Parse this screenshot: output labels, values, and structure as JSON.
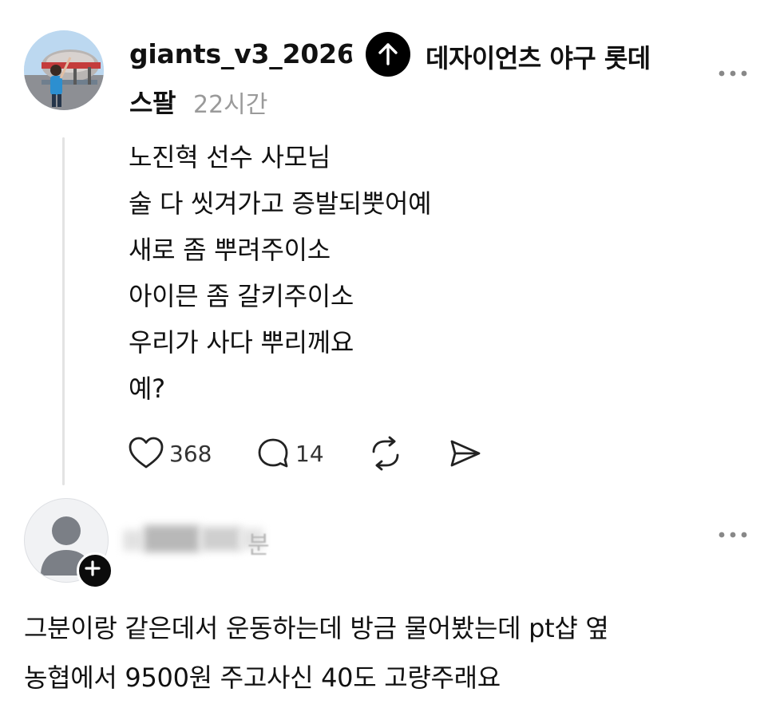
{
  "post": {
    "username": "giants_v3_2026",
    "tag_line1": "데자이언츠 야구 롯데",
    "tag_line2": "스팔",
    "time": "22시간",
    "body_lines": [
      "노진혁 선수 사모님",
      "술 다 씻겨가고 증발되뿟어예",
      "새로 좀 뿌려주이소",
      "아이믄 좀 갈키주이소",
      "우리가 사다 뿌리께요",
      "예?"
    ],
    "likes": "368",
    "comments": "14",
    "icons": {
      "avatar": "avatar-photo",
      "up": "arrow-up-icon",
      "more": "more-horizontal-icon",
      "like": "heart-icon",
      "comment": "comment-icon",
      "repost": "repost-icon",
      "share": "share-icon"
    }
  },
  "reply": {
    "username_visible_tail": "분",
    "body_lines": [
      "그분이랑 같은데서 운동하는데 방금 물어봤는데 pt샵 옆",
      "농협에서 9500원 주고사신 40도 고량주래요"
    ],
    "icons": {
      "avatar": "default-avatar-icon",
      "follow": "plus-icon",
      "more": "more-horizontal-icon"
    }
  },
  "colors": {
    "text": "#111111",
    "muted": "#9a9a9a",
    "thread_line": "#e3e3e3",
    "badge": "#000000"
  }
}
